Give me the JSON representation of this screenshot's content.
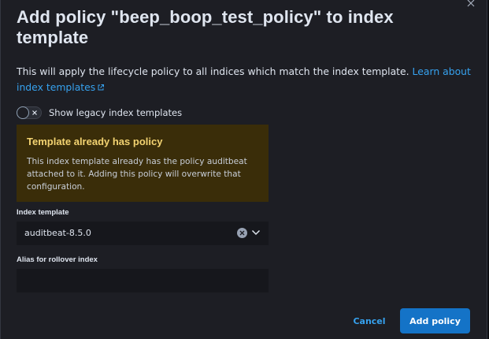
{
  "modal": {
    "title": "Add policy \"beep_boop_test_policy\" to index template",
    "description": "This will apply the lifecycle policy to all indices which match the index template.",
    "learn_link": "Learn about index templates",
    "close_icon": "close-icon",
    "external_icon": "external-link-icon"
  },
  "legacy_switch": {
    "label": "Show legacy index templates",
    "checked": false
  },
  "callout": {
    "title": "Template already has policy",
    "body": "This index template already has the policy auditbeat attached to it. Adding this policy will overwrite that configuration.",
    "color": "#f3d371"
  },
  "index_template": {
    "label": "Index template",
    "value": "auditbeat-8.5.0"
  },
  "alias": {
    "label": "Alias for rollover index",
    "value": ""
  },
  "footer": {
    "cancel_label": "Cancel",
    "submit_label": "Add policy"
  },
  "colors": {
    "primary": "#1473c7",
    "link": "#36a2ef",
    "warning_bg": "#3a2d09",
    "panel_bg": "#1d1e24"
  }
}
